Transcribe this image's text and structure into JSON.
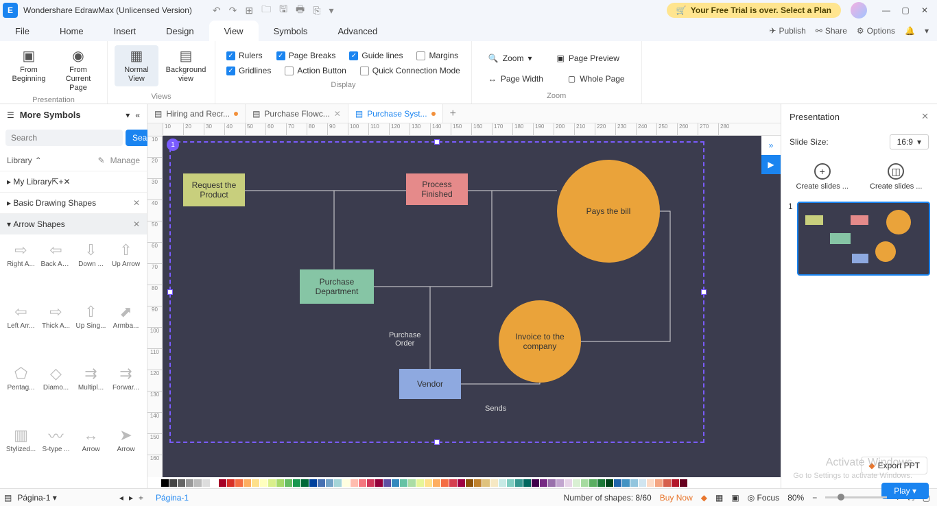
{
  "title_bar": {
    "app": "Wondershare EdrawMax (Unlicensed Version)",
    "trial_text": "Your Free Trial is over. Select a Plan"
  },
  "menu": {
    "tabs": [
      "File",
      "Home",
      "Insert",
      "Design",
      "View",
      "Symbols",
      "Advanced"
    ],
    "active_index": 4,
    "right": {
      "publish": "Publish",
      "share": "Share",
      "options": "Options"
    }
  },
  "ribbon": {
    "presentation": {
      "label": "Presentation",
      "from_beginning": "From\nBeginning",
      "from_current": "From Current\nPage"
    },
    "views": {
      "label": "Views",
      "normal": "Normal\nView",
      "background": "Background\nview"
    },
    "display": {
      "label": "Display",
      "rulers": "Rulers",
      "page_breaks": "Page Breaks",
      "guide_lines": "Guide lines",
      "margins": "Margins",
      "gridlines": "Gridlines",
      "action_button": "Action Button",
      "quick_connection": "Quick Connection Mode"
    },
    "zoom": {
      "label": "Zoom",
      "zoom": "Zoom",
      "page_preview": "Page Preview",
      "page_width": "Page Width",
      "whole_page": "Whole Page"
    }
  },
  "sidebar": {
    "title": "More Symbols",
    "search_placeholder": "Search",
    "search_button": "Search",
    "library": "Library",
    "manage": "Manage",
    "my_library": "My Library",
    "categories": [
      {
        "label": "Basic Drawing Shapes"
      },
      {
        "label": "Arrow Shapes"
      }
    ],
    "shapes": [
      "Right A...",
      "Back Arr...",
      "Down ...",
      "Up Arrow",
      "Left Arr...",
      "Thick A...",
      "Up Sing...",
      "Armba...",
      "Pentag...",
      "Diamo...",
      "Multipl...",
      "Forwar...",
      "Stylized...",
      "S-type ...",
      "Arrow",
      "Arrow"
    ]
  },
  "documents": {
    "tabs": [
      {
        "label": "Hiring and Recr...",
        "dirty": true
      },
      {
        "label": "Purchase Flowc...",
        "dirty": false
      },
      {
        "label": "Purchase Syst...",
        "dirty": true
      }
    ],
    "active_index": 2
  },
  "ruler_h": [
    "10",
    "20",
    "30",
    "40",
    "50",
    "60",
    "70",
    "80",
    "90",
    "100",
    "110",
    "120",
    "130",
    "140",
    "150",
    "160",
    "170",
    "180",
    "190",
    "200",
    "210",
    "220",
    "230",
    "240",
    "250",
    "260",
    "270",
    "280"
  ],
  "ruler_v": [
    "10",
    "20",
    "30",
    "40",
    "50",
    "60",
    "70",
    "80",
    "90",
    "100",
    "110",
    "120",
    "130",
    "140",
    "150",
    "160"
  ],
  "flow": {
    "sel_tag": "1",
    "request": "Request the\nProduct",
    "process": "Process\nFinished",
    "purchase": "Purchase\nDepartment",
    "vendor": "Vendor",
    "pays": "Pays the bill",
    "invoice": "Invoice to the\ncompany",
    "edge_po": "Purchase\nOrder",
    "edge_sends": "Sends"
  },
  "right_panel": {
    "title": "Presentation",
    "slide_size_label": "Slide Size:",
    "slide_size_value": "16:9",
    "create1": "Create slides ...",
    "create2": "Create slides ...",
    "slide_index": "1",
    "play": "Play",
    "export": "Export PPT"
  },
  "pages": {
    "active": "Página-1",
    "tab": "Página-1"
  },
  "status": {
    "shapes": "Number of shapes: 8/60",
    "buy": "Buy Now",
    "focus": "Focus",
    "zoom": "80%"
  },
  "watermark": {
    "l1": "Activate Windows",
    "l2": "Go to Settings to activate Windows."
  },
  "color_palette": [
    "#000",
    "#444",
    "#666",
    "#999",
    "#bbb",
    "#ddd",
    "#fff",
    "#a50026",
    "#d73027",
    "#f46d43",
    "#fdae61",
    "#fee08b",
    "#ffffbf",
    "#d9ef8b",
    "#a6d96a",
    "#66bd63",
    "#1a9850",
    "#006837",
    "#00429d",
    "#4771b2",
    "#73a2c6",
    "#a5d5d8",
    "#ffffe0",
    "#ffbcaf",
    "#f4777f",
    "#cf3759",
    "#93003a",
    "#5e4fa2",
    "#3288bd",
    "#66c2a5",
    "#abdda4",
    "#e6f598",
    "#fee08b",
    "#fdae61",
    "#f46d43",
    "#d53e4f",
    "#9e0142",
    "#8c510a",
    "#bf812d",
    "#dfc27d",
    "#f6e8c3",
    "#c7eae5",
    "#80cdc1",
    "#35978f",
    "#01665e",
    "#40004b",
    "#762a83",
    "#9970ab",
    "#c2a5cf",
    "#e7d4e8",
    "#d9f0d3",
    "#a6dba0",
    "#5aae61",
    "#1b7837",
    "#00441b",
    "#2166ac",
    "#4393c3",
    "#92c5de",
    "#d1e5f0",
    "#fddbc7",
    "#f4a582",
    "#d6604d",
    "#b2182b",
    "#67001f"
  ]
}
